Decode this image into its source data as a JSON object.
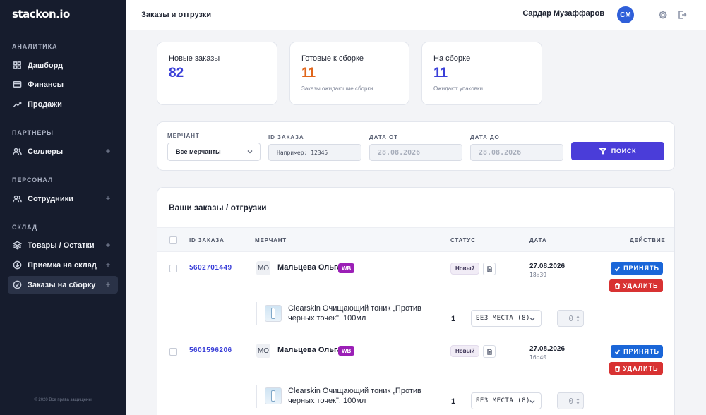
{
  "sidebar": {
    "logo": "stackon.io",
    "sections": [
      {
        "title": "Аналитика",
        "items": [
          {
            "label": "Дашборд",
            "icon": "home-icon"
          },
          {
            "label": "Финансы",
            "icon": "card-icon"
          },
          {
            "label": "Продажи",
            "icon": "trend-icon"
          }
        ]
      },
      {
        "title": "Партнеры",
        "items": [
          {
            "label": "Селлеры",
            "icon": "users-icon"
          }
        ]
      },
      {
        "title": "Персонал",
        "items": [
          {
            "label": "Сотрудники",
            "icon": "users-icon"
          }
        ]
      },
      {
        "title": "Склад",
        "items": [
          {
            "label": "Товары / Остатки",
            "icon": "layers-icon"
          },
          {
            "label": "Приемка на склад",
            "icon": "circle-arrow-icon"
          },
          {
            "label": "Заказы на сборку",
            "icon": "check-circle-icon",
            "active": true
          }
        ]
      }
    ],
    "copyright": "© 2020 Все права защищены"
  },
  "header": {
    "title": "Заказы и отгрузки",
    "user_name": "Сардар Музаффаров",
    "avatar_initials": "СМ"
  },
  "stats": [
    {
      "label": "Новые заказы",
      "value": "82",
      "sub": "",
      "color": "#3a3fd8"
    },
    {
      "label": "Готовые к сборке",
      "value": "11",
      "sub": "Заказы ожидающие сборки",
      "color": "#e0661b"
    },
    {
      "label": "На сборке",
      "value": "11",
      "sub": "Ожидают упаковки",
      "color": "#3a3fd8"
    }
  ],
  "filter": {
    "merchant_label": "Мерчант",
    "merchant_value": "Все мерчанты",
    "order_id_label": "ID заказа",
    "order_id_placeholder": "Например: 12345",
    "date_from_label": "Дата от",
    "date_from_value": "28.08.2026",
    "date_to_label": "Дата до",
    "date_to_value": "28.08.2026",
    "search_label": "Поиск"
  },
  "orders": {
    "title": "Ваши заказы / отгрузки",
    "columns": [
      "ID заказа",
      "Мерчант",
      "Статус",
      "Дата",
      "Действие"
    ],
    "rows": [
      {
        "id": "5602701449",
        "merchant_initials": "МО",
        "merchant": "Мальцева Ольга",
        "marketplace": "WB",
        "status": "Новый",
        "date": "27.08.2026",
        "time": "18:39",
        "accept_label": "Принять",
        "delete_label": "Удалить",
        "item": {
          "name": "Clearskin Очищающий тоник „Против черных точек\", 100мл",
          "qty": "1",
          "place": "БЕЗ МЕСТА (8)",
          "count": "0"
        }
      },
      {
        "id": "5601596206",
        "merchant_initials": "МО",
        "merchant": "Мальцева Ольга",
        "marketplace": "WB",
        "status": "Новый",
        "date": "27.08.2026",
        "time": "16:40",
        "accept_label": "Принять",
        "delete_label": "Удалить",
        "item": {
          "name": "Clearskin Очищающий тоник „Против черных точек\", 100мл",
          "qty": "1",
          "place": "БЕЗ МЕСТА (8)",
          "count": "0"
        }
      }
    ]
  }
}
